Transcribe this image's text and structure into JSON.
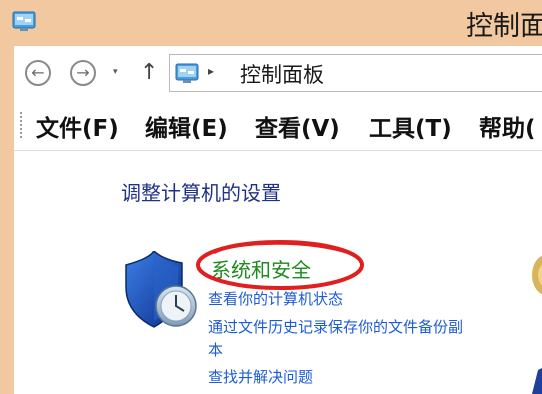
{
  "window": {
    "title": "控制面"
  },
  "nav": {
    "back_symbol": "←",
    "forward_symbol": "→",
    "dropdown_symbol": "▾",
    "up_symbol": "↑",
    "breadcrumb_separator": "▸",
    "address_text": "控制面板"
  },
  "menu": {
    "items": [
      "文件(F)",
      "编辑(E)",
      "查看(V)",
      "工具(T)",
      "帮助("
    ]
  },
  "content": {
    "heading": "调整计算机的设置",
    "category": {
      "title": "系统和安全",
      "links": [
        "查看你的计算机状态",
        "通过文件历史记录保存你的文件备份副",
        "本",
        "查找并解决问题"
      ]
    }
  },
  "colors": {
    "titlebar": "#f2c8a0",
    "heading": "#1e3287",
    "category_title": "#1f8a1f",
    "link": "#1c5bd6",
    "annotation": "#e02020"
  },
  "icons": {
    "app": "control-panel-icon",
    "category": "shield-icon"
  }
}
